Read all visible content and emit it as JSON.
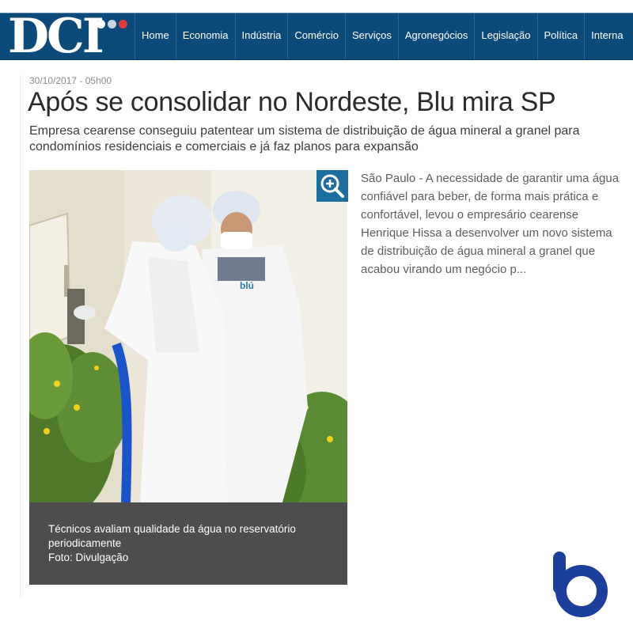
{
  "brand": {
    "logo_text": "DCI"
  },
  "nav": {
    "items": [
      "Home",
      "Economia",
      "Indústria",
      "Comércio",
      "Serviços",
      "Agronegócios",
      "Legislação",
      "Política",
      "Interna"
    ]
  },
  "article": {
    "date": "30/10/2017 - 05h00",
    "headline": "Após se consolidar no Nordeste, Blu mira SP",
    "subtitle": "Empresa cearense conseguiu patentear um sistema de distribuição de água mineral a granel para condomínios residenciais e comerciais e já faz planos para expansão",
    "teaser": "São Paulo - A necessidade de garantir uma água confiável para beber, de forma mais prática e confortável, levou o empresário cearense Henrique Hissa a desenvolver um novo sistema de distribuição de água mineral a granel que acabou virando um negócio p...",
    "photo": {
      "caption_line1": "Técnicos avaliam qualidade da água no reservatório periodicamente",
      "caption_line2": "Foto: Divulgação",
      "coat_logo_text": "blú"
    }
  },
  "icons": {
    "zoom": "zoom-in-icon",
    "brand_mark": "b-logo-icon"
  },
  "colors": {
    "navbar": "#0c4a7a",
    "zoom_button": "#1c6ea0",
    "caption_bg": "#4d4d4d",
    "brand_blue": "#1b3f9a",
    "dot_red": "#e03c3c"
  }
}
